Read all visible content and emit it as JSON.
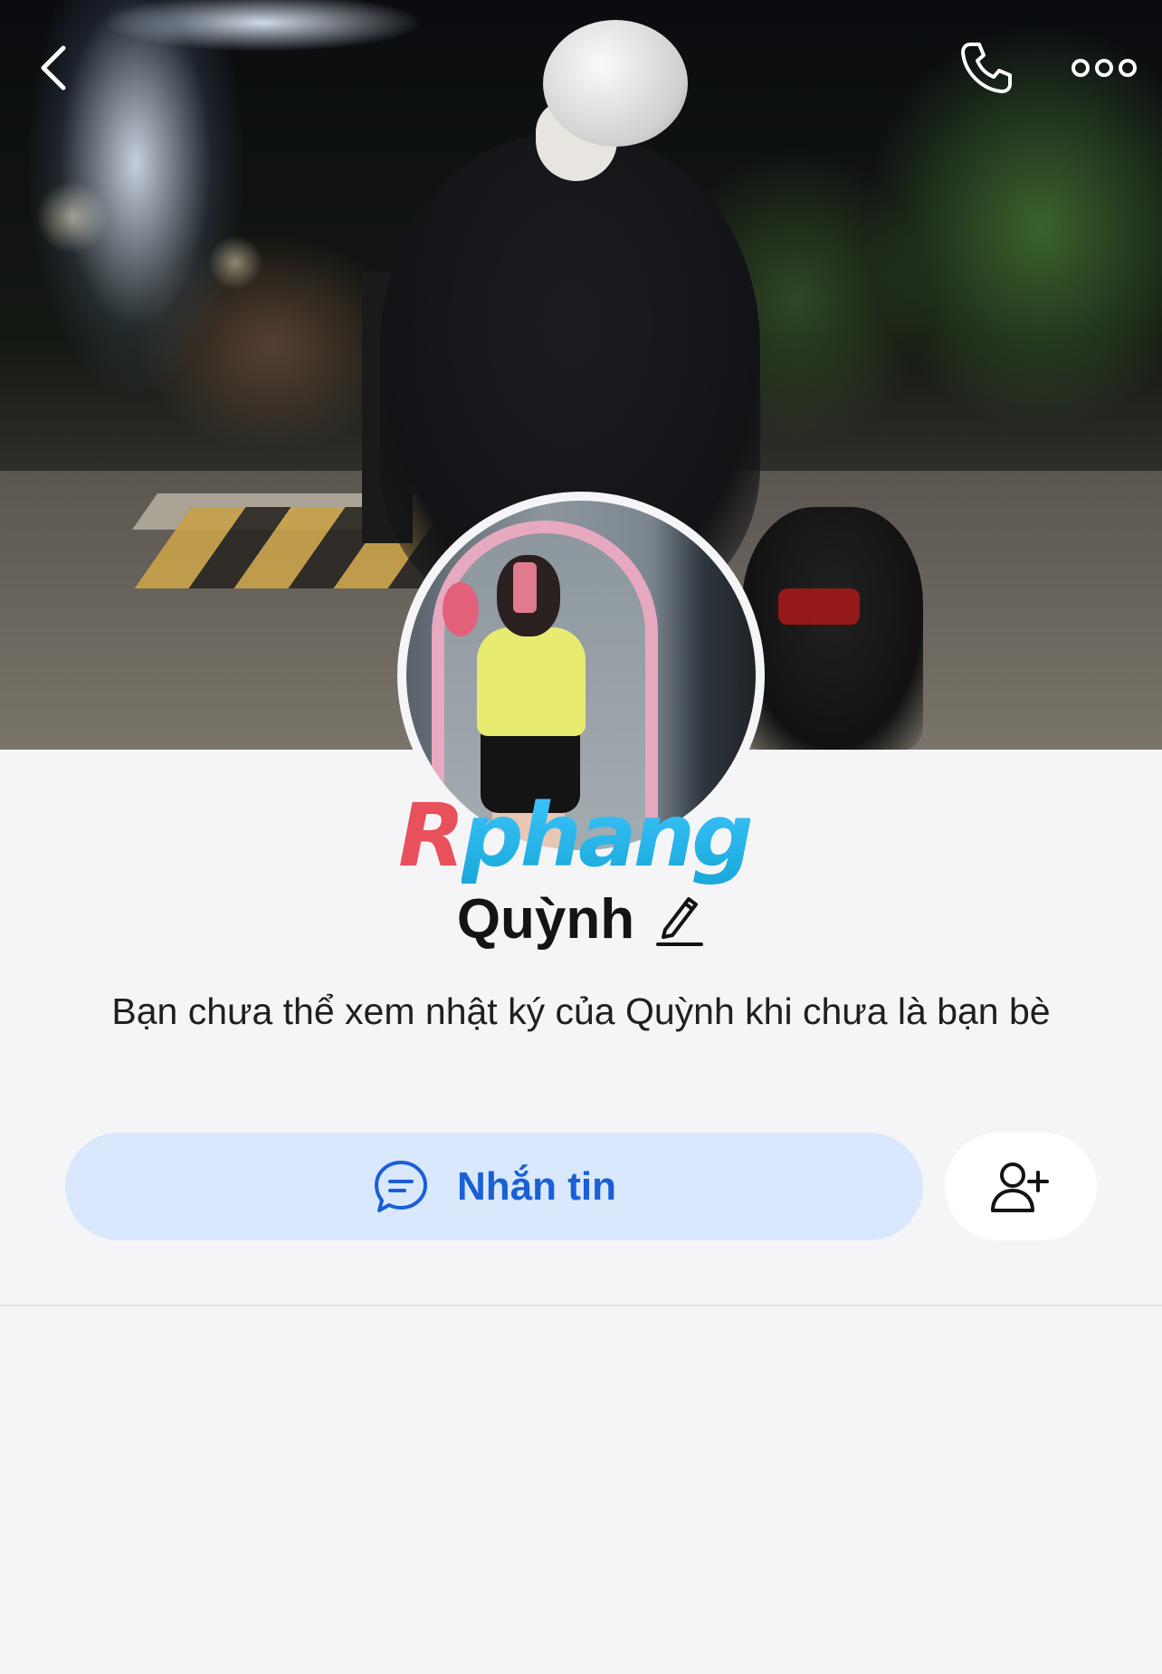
{
  "profile": {
    "name": "Quỳnh",
    "notice": "Bạn chưa thể xem nhật ký của Quỳnh khi chưa là bạn bè"
  },
  "watermark": {
    "first": "R",
    "rest": "phang"
  },
  "actions": {
    "message_label": "Nhắn tin"
  },
  "icons": {
    "back": "chevron-left-icon",
    "call": "phone-icon",
    "more": "more-dots-icon",
    "edit": "pencil-icon",
    "message": "chat-bubble-icon",
    "add_friend": "add-user-icon"
  },
  "colors": {
    "accent": "#1a5fd6",
    "message_button_bg": "#d9e8fd",
    "page_bg": "#f5f5f8"
  }
}
